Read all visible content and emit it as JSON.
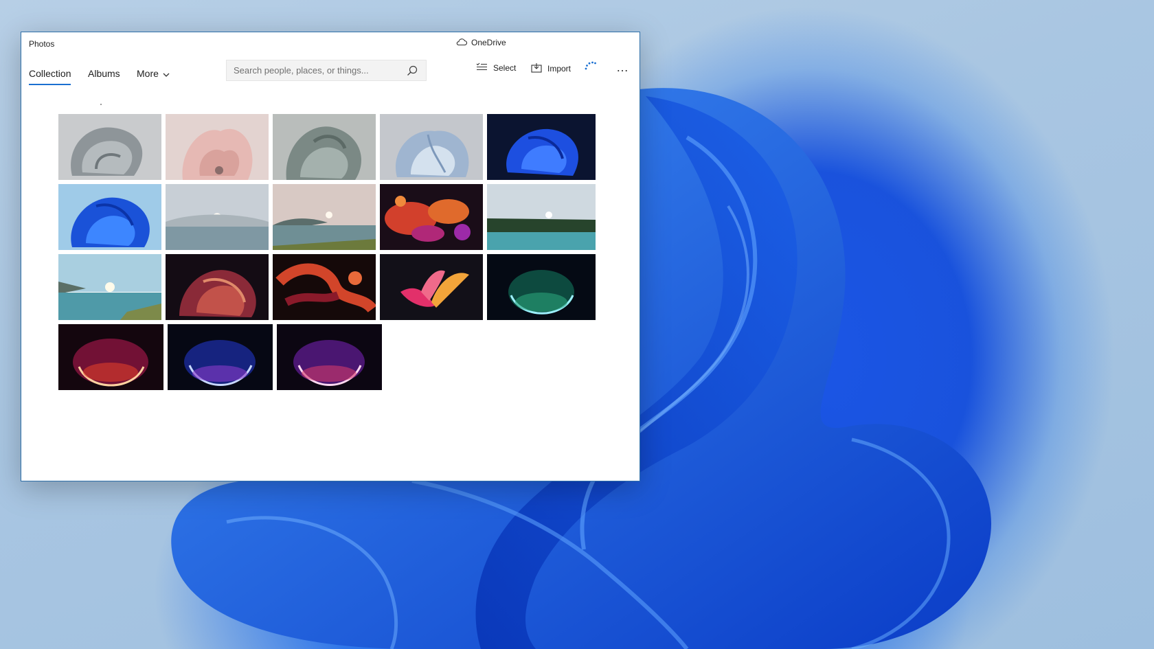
{
  "window": {
    "app_title": "Photos",
    "onedrive_label": "OneDrive"
  },
  "nav": {
    "tabs": [
      {
        "label": "Collection",
        "active": true
      },
      {
        "label": "Albums",
        "active": false
      },
      {
        "label": "More",
        "active": false
      }
    ]
  },
  "search": {
    "placeholder": "Search people, places, or things..."
  },
  "toolbar": {
    "select_label": "Select",
    "import_label": "Import"
  },
  "icons": {
    "onedrive": "cloud-icon",
    "more": "chevron-down-icon",
    "search": "search-icon",
    "select": "select-list-icon",
    "import": "import-icon",
    "sync": "sync-spinner-icon",
    "overflow": "more-dots-icon"
  },
  "colors": {
    "accent": "#1a6fd1",
    "window_border": "#2e6fa8"
  },
  "gallery": {
    "rows": [
      [
        {
          "name": "Grey flowing bloom"
        },
        {
          "name": "Pink flowing bloom"
        },
        {
          "name": "Sage flowing bloom"
        },
        {
          "name": "Light blue flowing bloom"
        },
        {
          "name": "Blue bloom on dark"
        }
      ],
      [
        {
          "name": "Blue bloom on light"
        },
        {
          "name": "Misty lake sunrise"
        },
        {
          "name": "Lake sunrise hills"
        },
        {
          "name": "Orange abstract shapes"
        },
        {
          "name": "Forest lake"
        }
      ],
      [
        {
          "name": "Lake horizon sun"
        },
        {
          "name": "Crimson swirl"
        },
        {
          "name": "Red ribbons"
        },
        {
          "name": "Pink petals"
        },
        {
          "name": "Green glow arc"
        }
      ],
      [
        {
          "name": "Red glow arc"
        },
        {
          "name": "Blue glow arc"
        },
        {
          "name": "Purple glow arc"
        }
      ]
    ]
  }
}
